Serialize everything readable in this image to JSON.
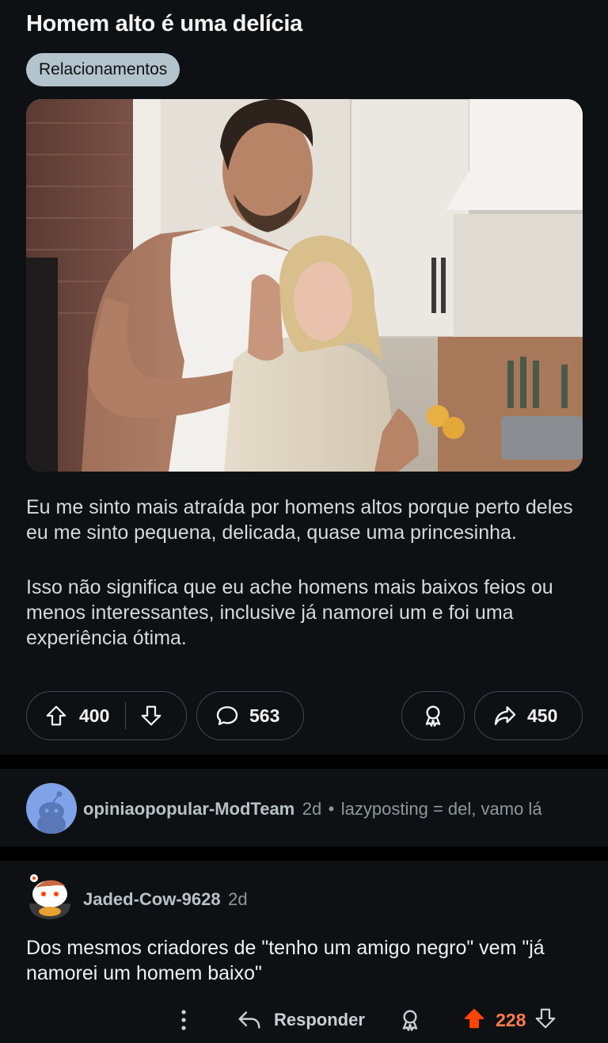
{
  "post": {
    "title": "Homem alto é uma delícia",
    "flair": "Relacionamentos",
    "paragraphs": [
      "Eu me sinto mais atraída por homens altos porque perto deles eu me sinto pequena, delicada, quase uma princesinha.",
      "Isso não significa que eu ache homens mais baixos feios ou menos interessantes, inclusive já namorei um e foi uma experiência ótima."
    ],
    "upvotes": "400",
    "comments": "563",
    "shares": "450",
    "icons": [
      "upvote-icon",
      "downvote-icon",
      "comment-icon",
      "award-icon",
      "share-icon"
    ]
  },
  "comments": [
    {
      "username": "opiniaopopular-ModTeam",
      "age": "2d",
      "separator": "•",
      "text": "lazyposting = del, vamo lá"
    },
    {
      "username": "Jaded-Cow-9628",
      "age": "2d",
      "text": "Dos mesmos criadores de \"tenho um amigo negro\" vem \"já namorei um homem baixo\"",
      "reply_label": "Responder",
      "score": "228"
    }
  ],
  "colors": {
    "background": "#0e1113",
    "upvote_active": "#ff4500",
    "score_active": "#ff7b4a",
    "flair_bg": "#b4c4cc"
  }
}
